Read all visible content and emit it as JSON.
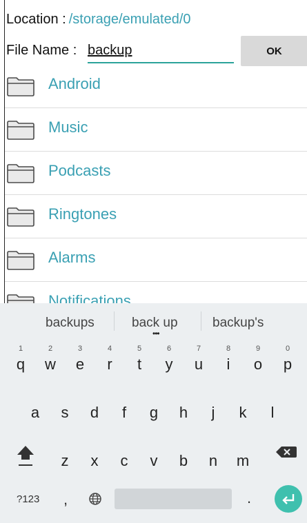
{
  "location": {
    "label": "Location :",
    "path": "/storage/emulated/0"
  },
  "filename": {
    "label": "File Name :",
    "value": "backup",
    "ok_label": "OK"
  },
  "folders": [
    {
      "name": "Android",
      "icon": "folder-icon"
    },
    {
      "name": "Music",
      "icon": "folder-icon"
    },
    {
      "name": "Podcasts",
      "icon": "folder-icon"
    },
    {
      "name": "Ringtones",
      "icon": "folder-icon"
    },
    {
      "name": "Alarms",
      "icon": "folder-icon"
    },
    {
      "name": "Notifications",
      "icon": "folder-icon"
    }
  ],
  "keyboard": {
    "suggestions": [
      "backups",
      "back up",
      "backup's"
    ],
    "row1": [
      {
        "k": "q",
        "n": "1"
      },
      {
        "k": "w",
        "n": "2"
      },
      {
        "k": "e",
        "n": "3"
      },
      {
        "k": "r",
        "n": "4"
      },
      {
        "k": "t",
        "n": "5"
      },
      {
        "k": "y",
        "n": "6"
      },
      {
        "k": "u",
        "n": "7"
      },
      {
        "k": "i",
        "n": "8"
      },
      {
        "k": "o",
        "n": "9"
      },
      {
        "k": "p",
        "n": "0"
      }
    ],
    "row2": [
      "a",
      "s",
      "d",
      "f",
      "g",
      "h",
      "j",
      "k",
      "l"
    ],
    "row3": [
      "z",
      "x",
      "c",
      "v",
      "b",
      "n",
      "m"
    ],
    "symbols_label": "?123",
    "comma": ",",
    "period": "."
  },
  "colors": {
    "accent": "#3aa0b3",
    "underline": "#2aa39a",
    "enter": "#3fc0ae"
  }
}
